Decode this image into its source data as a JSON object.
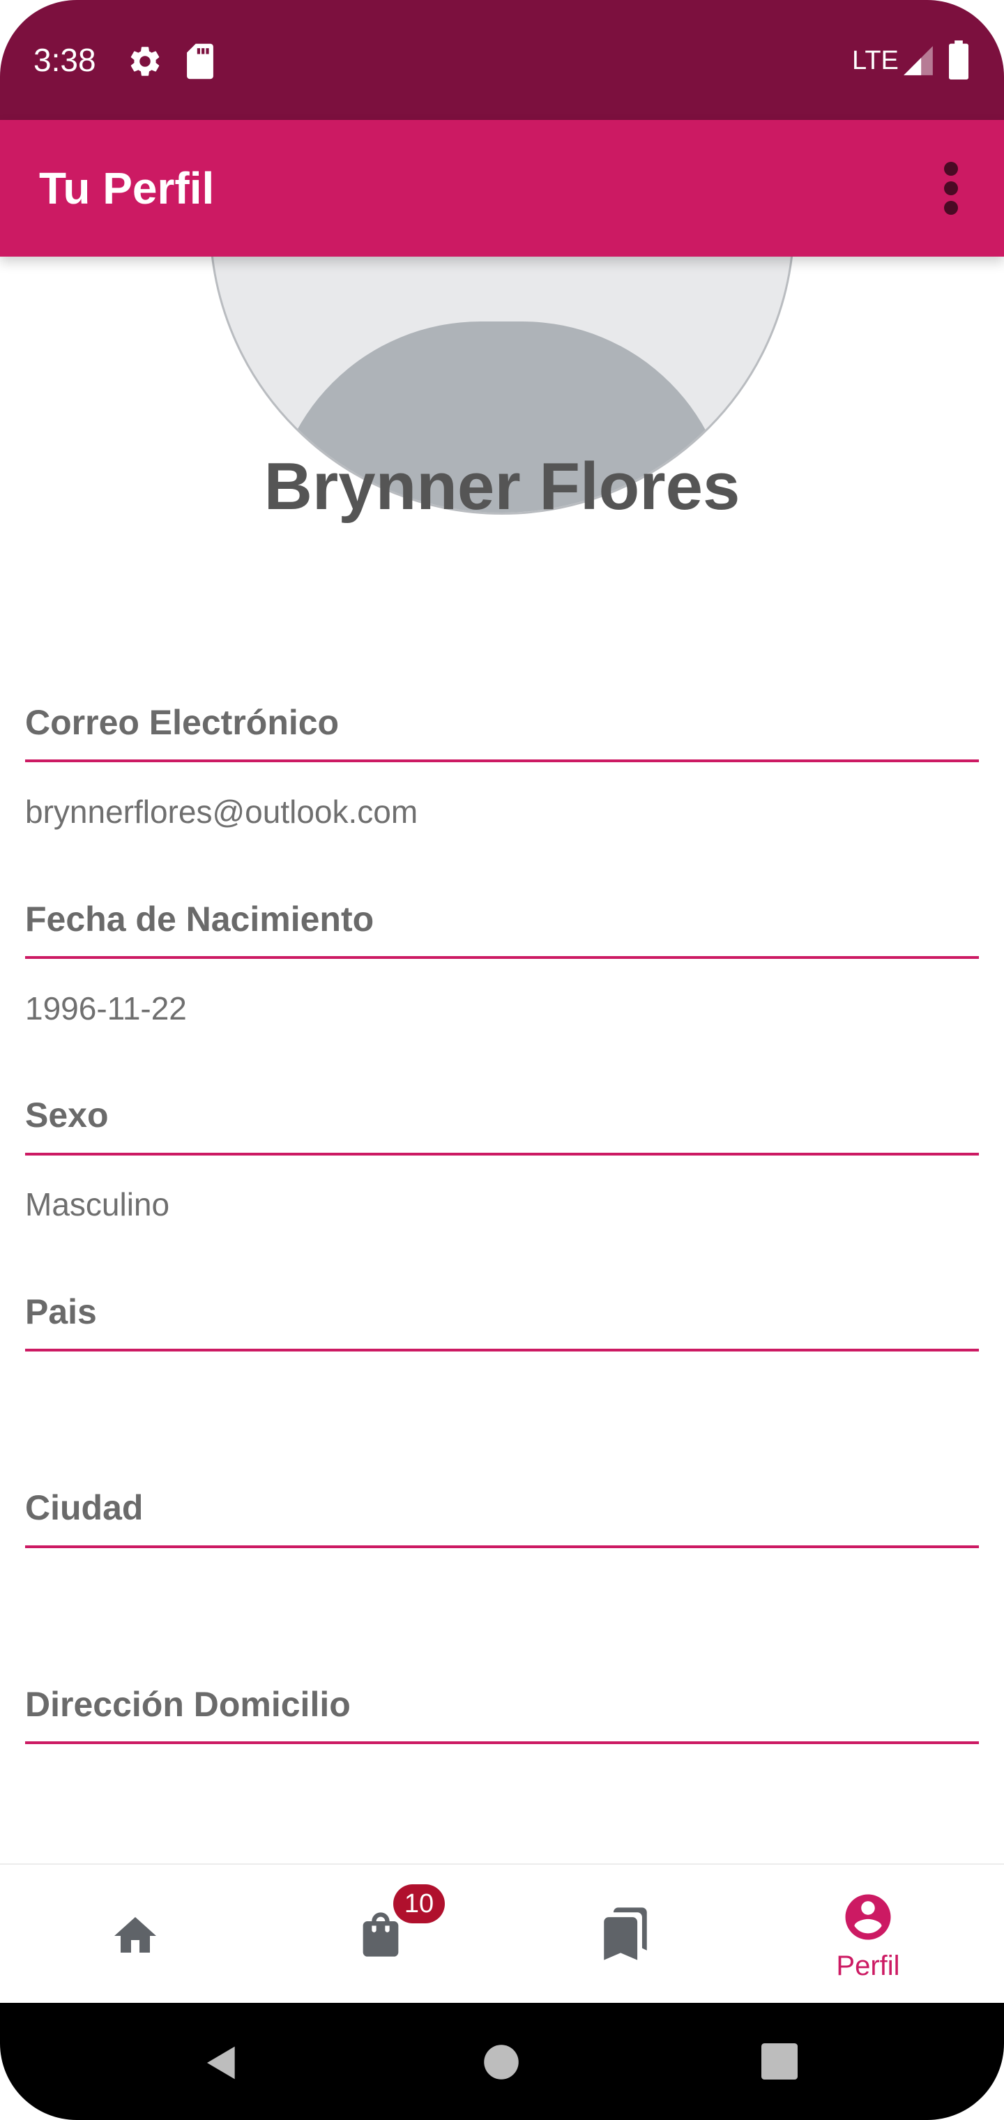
{
  "colors": {
    "status_bar": "#7c103e",
    "app_bar": "#cc1a63",
    "accent": "#cc1a63",
    "badge": "#b0102d",
    "nav_inactive": "#5f6368",
    "label_text": "#6a6a6a",
    "value_text": "#6f6f6f"
  },
  "status_bar": {
    "time": "3:38",
    "network": "LTE",
    "icons": [
      "gear-icon",
      "sd-card-icon",
      "signal-icon",
      "battery-icon"
    ]
  },
  "app_bar": {
    "title": "Tu Perfil",
    "menu_icon": "more-vertical-icon"
  },
  "profile": {
    "name": "Brynner Flores",
    "avatar_icon": "default-avatar-icon"
  },
  "fields": [
    {
      "label": "Correo Electrónico",
      "value": "brynnerflores@outlook.com"
    },
    {
      "label": "Fecha de Nacimiento",
      "value": "1996-11-22"
    },
    {
      "label": "Sexo",
      "value": "Masculino"
    },
    {
      "label": "Pais",
      "value": ""
    },
    {
      "label": "Ciudad",
      "value": ""
    },
    {
      "label": "Dirección Domicilio",
      "value": ""
    }
  ],
  "bottom_nav": {
    "items": [
      {
        "icon": "home-icon",
        "label": "",
        "active": false
      },
      {
        "icon": "shopping-bag-icon",
        "label": "",
        "badge": "10",
        "active": false
      },
      {
        "icon": "bookmarks-icon",
        "label": "",
        "active": false
      },
      {
        "icon": "account-circle-icon",
        "label": "Perfil",
        "active": true
      }
    ]
  },
  "system_nav": {
    "icons": [
      "back-icon",
      "home-circle-icon",
      "recents-icon"
    ]
  }
}
